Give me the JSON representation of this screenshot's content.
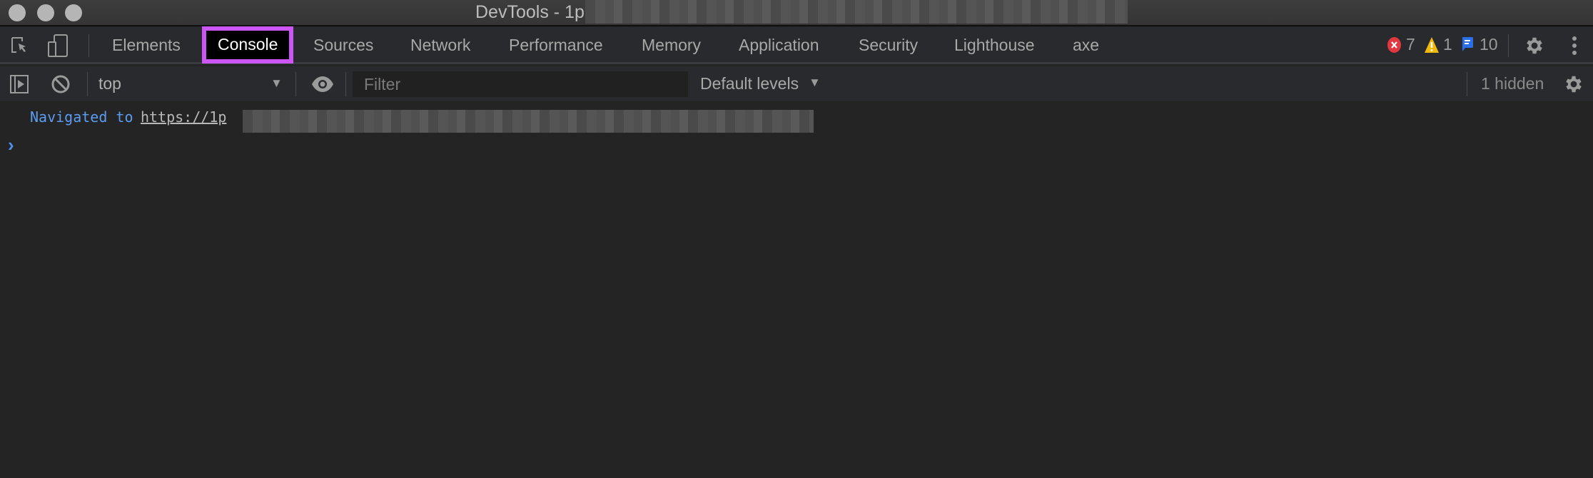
{
  "window": {
    "title": "DevTools - 1p"
  },
  "tabs": [
    {
      "label": "Elements",
      "active": false
    },
    {
      "label": "Console",
      "active": true
    },
    {
      "label": "Sources",
      "active": false
    },
    {
      "label": "Network",
      "active": false
    },
    {
      "label": "Performance",
      "active": false
    },
    {
      "label": "Memory",
      "active": false
    },
    {
      "label": "Application",
      "active": false
    },
    {
      "label": "Security",
      "active": false
    },
    {
      "label": "Lighthouse",
      "active": false
    },
    {
      "label": "axe",
      "active": false
    }
  ],
  "status": {
    "errors": "7",
    "warnings": "1",
    "messages": "10"
  },
  "toolbar": {
    "context": "top",
    "filter_placeholder": "Filter",
    "levels": "Default levels",
    "hidden": "1 hidden"
  },
  "console": {
    "messages": [
      {
        "prefix": "Navigated to",
        "url": "https://1p"
      }
    ],
    "prompt": "›"
  },
  "colors": {
    "highlight": "#cc55f5",
    "link_blue": "#5b9cf0",
    "error": "#e0383e",
    "warning": "#f2b90d",
    "info": "#2a6ee8"
  }
}
